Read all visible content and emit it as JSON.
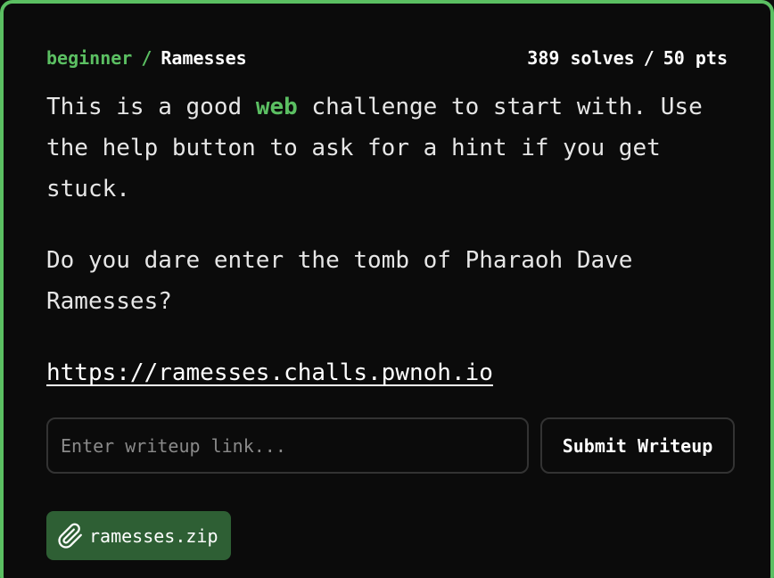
{
  "challenge": {
    "category": "beginner",
    "separator": "/",
    "name": "Ramesses",
    "solves": "389 solves",
    "stats_separator": "/",
    "points": "50 pts"
  },
  "description": {
    "p1_before": "This is a good ",
    "p1_keyword": "web",
    "p1_after": " challenge to start with. Use the help button to ask for a hint if you get stuck.",
    "p2": "Do you dare enter the tomb of Pharaoh Dave Ramesses?"
  },
  "link": {
    "text": "https://ramesses.challs.pwnoh.io"
  },
  "writeup": {
    "placeholder": "Enter writeup link...",
    "value": "",
    "submit_label": "Submit Writeup"
  },
  "attachment": {
    "icon": "paperclip-icon",
    "filename": "ramesses.zip"
  },
  "colors": {
    "accent": "#5bbf62",
    "background": "#0b0b0b",
    "attachment_bg": "#2e5f34",
    "border": "#333333"
  }
}
